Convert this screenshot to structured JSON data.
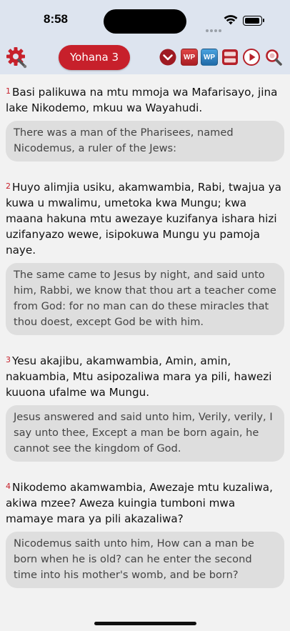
{
  "status_bar": {
    "time": "8:58"
  },
  "toolbar": {
    "book_chapter": "Yohana 3",
    "wp_red_label": "WP",
    "wp_blue_label": "WP"
  },
  "colors": {
    "accent": "#c7202b",
    "toolbar_bg": "#dde4ef",
    "bubble_bg": "#dedede"
  },
  "verses": [
    {
      "number": "1",
      "swahili": "Basi palikuwa na mtu mmoja wa Mafarisayo, jina lake Nikodemo, mkuu wa Wayahudi.",
      "english": "There was a man of the Pharisees, named Nicodemus, a ruler of the Jews:"
    },
    {
      "number": "2",
      "swahili": "Huyo alimjia usiku, akamwambia, Rabi, twajua ya kuwa u mwalimu, umetoka kwa Mungu; kwa maana hakuna mtu awezaye kuzifanya ishara hizi uzifanyazo wewe, isipokuwa Mungu yu pamoja naye.",
      "english": "The same came to Jesus by night, and said unto him, Rabbi, we know that thou art a teacher come from God: for no man can do these miracles that thou doest, except God be with him."
    },
    {
      "number": "3",
      "swahili": "Yesu akajibu, akamwambia, Amin, amin, nakuambia, Mtu asipozaliwa mara ya pili, hawezi kuuona ufalme wa Mungu.",
      "english": "Jesus answered and said unto him, Verily, verily, I say unto thee, Except a man be born again, he cannot see the kingdom of God."
    },
    {
      "number": "4",
      "swahili": "Nikodemo akamwambia, Awezaje mtu kuzaliwa, akiwa mzee? Aweza kuingia tumboni mwa mamaye mara ya pili akazaliwa?",
      "english": "Nicodemus saith unto him, How can a man be born when he is old? can he enter the second time into his mother's womb, and be born?"
    }
  ]
}
